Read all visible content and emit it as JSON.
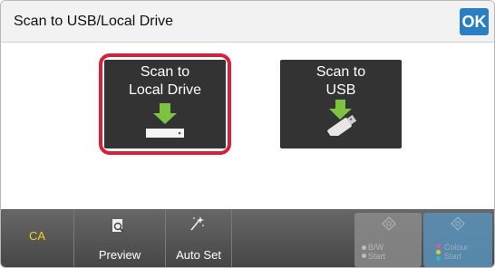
{
  "header": {
    "title": "Scan to USB/Local Drive",
    "ok_label": "OK"
  },
  "tiles": [
    {
      "line1": "Scan to",
      "line2": "Local Drive"
    },
    {
      "line1": "Scan to",
      "line2": "USB"
    }
  ],
  "toolbar": {
    "ca_label": "CA",
    "preview_label": "Preview",
    "autoset_label": "Auto Set",
    "bw_line1": "B/W",
    "bw_line2": "Start",
    "colour_line1": "Colour",
    "colour_line2": "Start"
  },
  "colors": {
    "selection": "#d91f3a",
    "ok_button": "#2a7ec4",
    "arrow": "#7ec242",
    "ca_text": "#f4d01d"
  },
  "icons": [
    "local-drive-icon",
    "usb-stick-icon",
    "preview-icon",
    "auto-set-icon",
    "bw-start-icon",
    "colour-start-icon"
  ]
}
